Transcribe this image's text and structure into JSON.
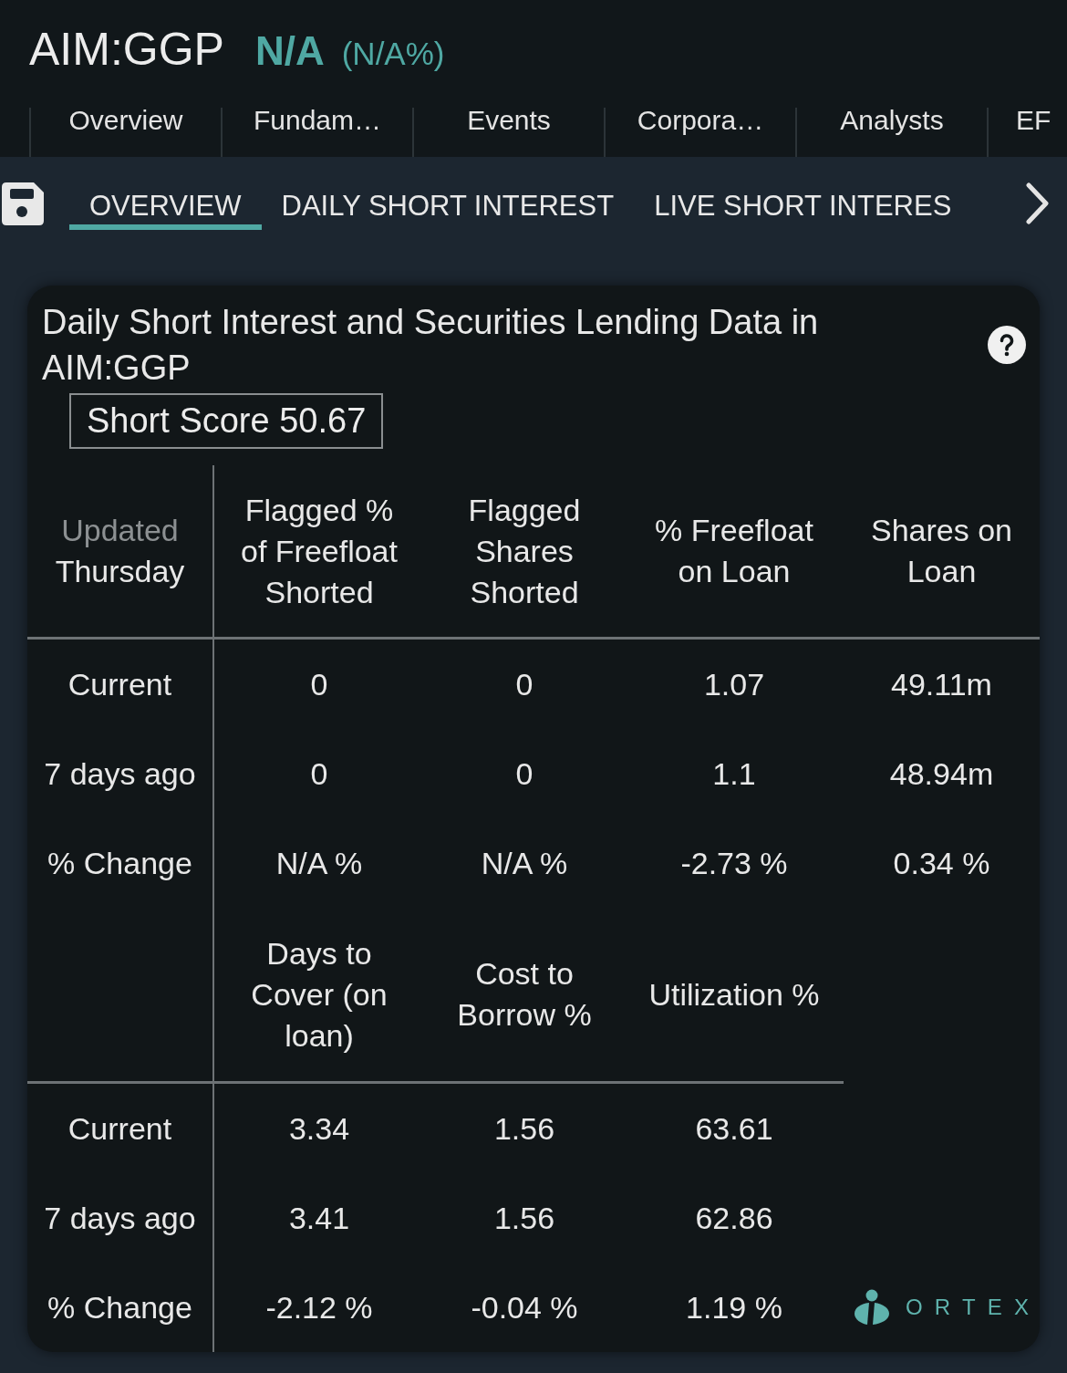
{
  "header": {
    "ticker": "AIM:GGP",
    "price": "N/A",
    "change": "(N/A%)"
  },
  "tabs": [
    {
      "label": "Overview",
      "selected": false
    },
    {
      "label": "Fundam…",
      "selected": false
    },
    {
      "label": "Events",
      "selected": false
    },
    {
      "label": "Corpora…",
      "selected": false
    },
    {
      "label": "Analysts",
      "selected": false
    },
    {
      "label": "EF",
      "selected": false
    }
  ],
  "subtabs": [
    {
      "label": "OVERVIEW",
      "selected": true
    },
    {
      "label": "DAILY SHORT INTEREST",
      "selected": false
    },
    {
      "label": "LIVE SHORT INTERES",
      "selected": false
    }
  ],
  "card": {
    "title": "Daily Short Interest and Securities Lending Data in AIM:GGP",
    "short_score": "Short Score 50.67",
    "tables": [
      {
        "corner": {
          "status": "Updated",
          "day": "Thursday"
        },
        "columns": [
          "Flagged % of Freefloat Shorted",
          "Flagged Shares Shorted",
          "% Freefloat on Loan",
          "Shares on Loan"
        ],
        "rows": [
          {
            "label": "Current",
            "values": [
              "0",
              "0",
              "1.07",
              "49.11m"
            ]
          },
          {
            "label": "7 days ago",
            "values": [
              "0",
              "0",
              "1.1",
              "48.94m"
            ]
          },
          {
            "label": "% Change",
            "values": [
              "N/A %",
              "N/A %",
              "-2.73 %",
              "0.34 %"
            ]
          }
        ]
      },
      {
        "columns": [
          "Days to Cover (on loan)",
          "Cost to Borrow %",
          "Utilization %"
        ],
        "rows": [
          {
            "label": "Current",
            "values": [
              "3.34",
              "1.56",
              "63.61"
            ]
          },
          {
            "label": "7 days ago",
            "values": [
              "3.41",
              "1.56",
              "62.86"
            ]
          },
          {
            "label": "% Change",
            "values": [
              "-2.12 %",
              "-0.04 %",
              "1.19 %"
            ]
          }
        ]
      }
    ],
    "logo": "ORTEX"
  }
}
